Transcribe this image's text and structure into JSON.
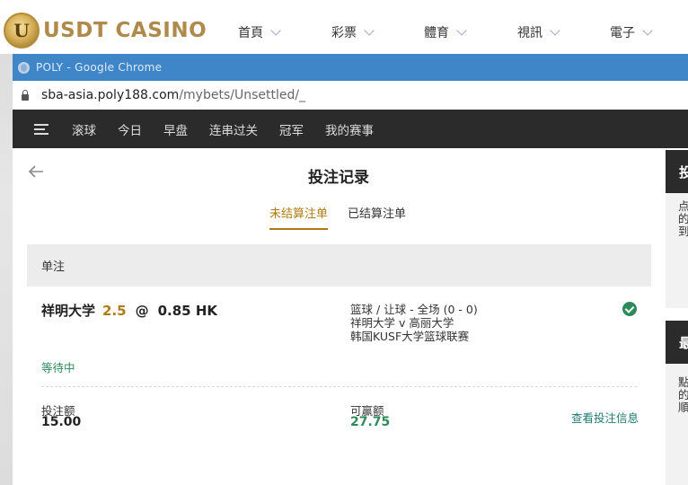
{
  "site": {
    "logo_letter": "U",
    "logo_text": "USDT CASINO",
    "nav": [
      {
        "label": "首頁"
      },
      {
        "label": "彩票"
      },
      {
        "label": "體育"
      },
      {
        "label": "視訊"
      },
      {
        "label": "電子"
      }
    ]
  },
  "browser": {
    "title": "POLY - Google Chrome",
    "url_host": "sba-asia.poly188.com",
    "url_path": "/mybets/Unsettled/_"
  },
  "app_nav": {
    "items": [
      {
        "label": "滚球"
      },
      {
        "label": "今日"
      },
      {
        "label": "早盘"
      },
      {
        "label": "连串过关"
      },
      {
        "label": "冠军"
      },
      {
        "label": "我的赛事"
      }
    ]
  },
  "page": {
    "title": "投注记录",
    "tabs": [
      {
        "label": "未结算注单",
        "active": true
      },
      {
        "label": "已结算注单",
        "active": false
      }
    ],
    "section_label": "单注",
    "bet": {
      "selection": "祥明大学",
      "handicap": "2.5",
      "at": "@",
      "odds": "0.85 HK",
      "market": "篮球 / 让球 - 全场 (0 - 0)",
      "match": "祥明大学 v 高丽大学",
      "league": "韩国KUSF大学篮球联赛",
      "status": "等待中",
      "stake_label": "投注额",
      "stake_value": "15.00",
      "win_label": "可赢额",
      "win_value": "27.75",
      "detail_link": "查看投注信息"
    }
  },
  "side": {
    "panel1_title": "投",
    "panel1_text": [
      "点",
      "的",
      "到"
    ],
    "panel2_title": "最",
    "panel2_text": [
      "點",
      "的",
      "順"
    ]
  },
  "colors": {
    "accent": "#b07a12",
    "success": "#2d8a5a",
    "link": "#1f7a73",
    "chrome_title_bar": "#3f86c9",
    "app_nav_bg": "#2b2b2b"
  }
}
